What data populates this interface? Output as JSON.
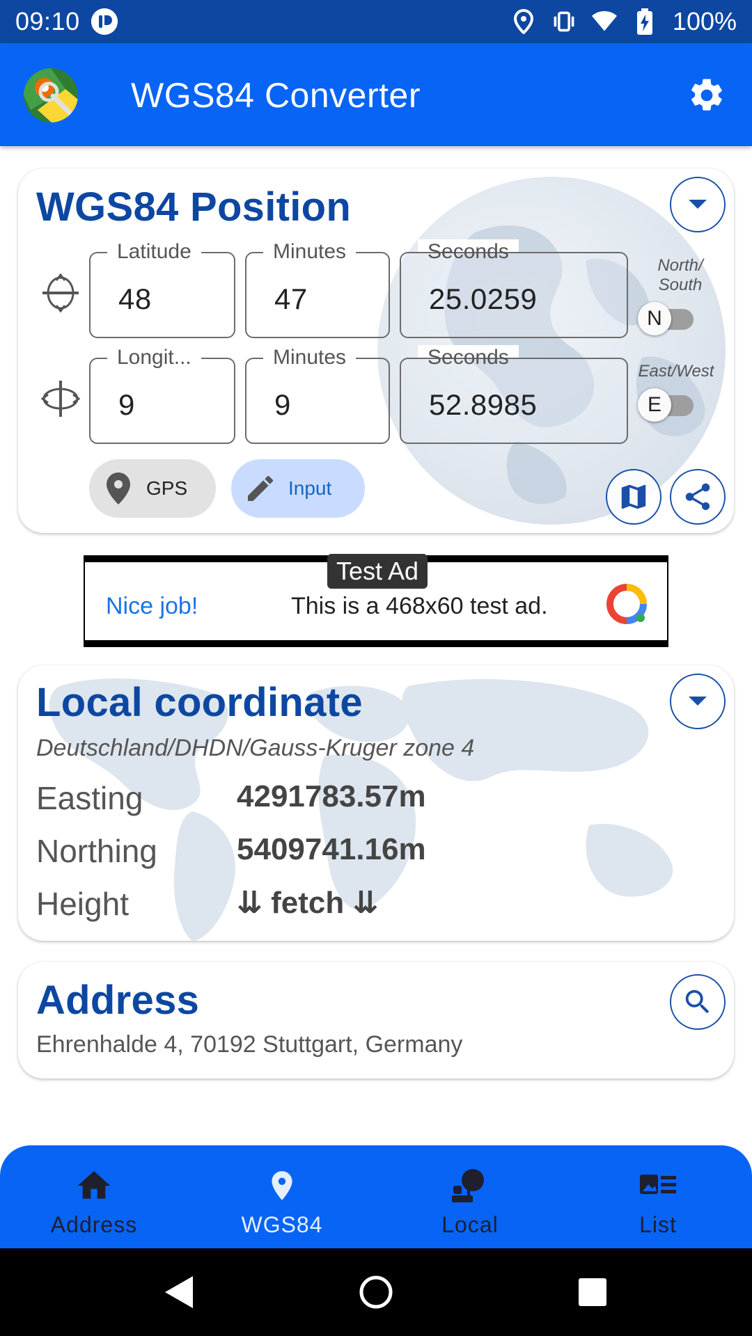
{
  "status_bar": {
    "time": "09:10",
    "battery": "100%"
  },
  "app_bar": {
    "title": "WGS84 Converter"
  },
  "wgs84": {
    "title": "WGS84 Position",
    "latitude": {
      "degrees_label": "Latitude",
      "degrees": "48",
      "minutes_label": "Minutes",
      "minutes": "47",
      "seconds_label": "Seconds",
      "seconds": "25.0259",
      "hemisphere_label": "North/\nSouth",
      "hemisphere": "N"
    },
    "longitude": {
      "degrees_label": "Longit...",
      "degrees": "9",
      "minutes_label": "Minutes",
      "minutes": "9",
      "seconds_label": "Seconds",
      "seconds": "52.8985",
      "hemisphere_label": "East/West",
      "hemisphere": "E"
    },
    "gps_chip": "GPS",
    "input_chip": "Input"
  },
  "ad": {
    "badge": "Test Ad",
    "headline": "Nice job!",
    "body": "This is a 468x60 test ad."
  },
  "local": {
    "title": "Local coordinate",
    "system": "Deutschland/DHDN/Gauss-Kruger zone 4",
    "easting_label": "Easting",
    "easting": "4291783.57m",
    "northing_label": "Northing",
    "northing": "5409741.16m",
    "height_label": "Height",
    "height": "⇊ fetch ⇊"
  },
  "address": {
    "title": "Address",
    "value": "Ehrenhalde 4, 70192 Stuttgart, Germany"
  },
  "bottom_nav": {
    "items": [
      {
        "label": "Address",
        "icon": "home-icon"
      },
      {
        "label": "WGS84",
        "icon": "location-pin-icon"
      },
      {
        "label": "Local",
        "icon": "globe-stand-icon"
      },
      {
        "label": "List",
        "icon": "list-icon"
      }
    ],
    "active_index": 1
  },
  "colors": {
    "primary": "#0764f5",
    "status_bar": "#0d47a1",
    "title_blue": "#0d47a1"
  }
}
